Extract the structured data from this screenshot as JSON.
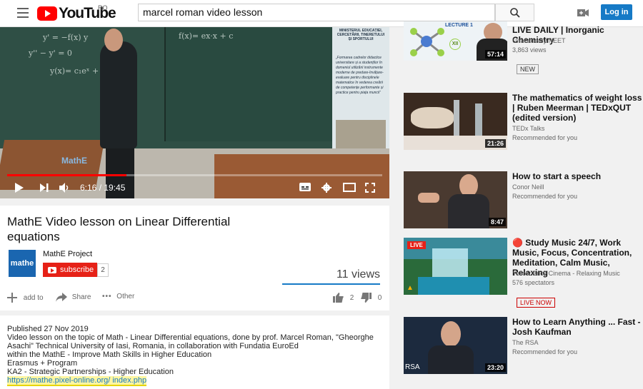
{
  "header": {
    "logo_text": "YouTube",
    "region": "RO",
    "search_query": "marcel roman video lesson",
    "login_label": "Log in"
  },
  "player": {
    "time": "6:16 / 19:45",
    "progress": 0.318,
    "poster_heading": "MINISTERUL EDUCAȚIEI, CERCETĂRII, TINERETULUI ȘI SPORTULUI",
    "poster_text": "„Formarea cadrelor didactice universitare și a studenților în domeniul utilizării instrumente moderne de predare-învățare-evaluare pentru disciplinele matematice în vederea creării de competențe performante și practice pentru piața muncii”",
    "watermark": "MathE"
  },
  "video": {
    "title": "MathE Video lesson on Linear Differential equations",
    "channel": "MathE Project",
    "avatar_text": "mathe",
    "subscribe_label": "subscribe",
    "subscriber_count": "2",
    "views": "11 views",
    "add_to": "add to",
    "share": "Share",
    "other": "Other",
    "likes": "2",
    "dislikes": "0"
  },
  "description": {
    "published": "Published 27 Nov 2019",
    "lines": [
      "Video lesson on the topic of Math - Linear Differential equations, done by prof. Marcel Roman, \"Gheorghe Asachi\" Technical University of Iasi, Romania, in collaboration with Fundatia EuroEd",
      "within the MathE - Improve Math Skills in Higher Education",
      "Erasmus + Program",
      "KA2 - Strategic Partnerships - Higher Education"
    ],
    "link": "https://mathe.pixel-online.org/ index.php"
  },
  "sidebar": [
    {
      "title": "LIVE DAILY | Inorganic Chemistry",
      "channel": "Unacademy NEET",
      "sub": "3,863 views",
      "badge": "NEW",
      "duration": "57:14",
      "thumb_lecture": "LECTURE 1",
      "thumb_class": "XII"
    },
    {
      "title": "The mathematics of weight loss | Ruben Meerman | TEDxQUT (edited version)",
      "channel": "TEDx Talks",
      "sub": "Recommended for you",
      "duration": "21:26"
    },
    {
      "title": "How to start a speech",
      "channel": "Conor Neill",
      "sub": "Recommended for you",
      "duration": "8:47"
    },
    {
      "title": "🔴 Study Music 24/7, Work Music, Focus, Concentration, Meditation, Calm Music, Relaxing",
      "channel": "Yellow Brick Cinema - Relaxing Music",
      "sub": "576 spectators",
      "badge": "LIVE NOW",
      "live": "LIVE"
    },
    {
      "title": "How to Learn Anything ... Fast - Josh Kaufman",
      "channel": "The RSA",
      "sub": "Recommended for you",
      "duration": "23:20",
      "thumb_label": "RSA"
    }
  ]
}
